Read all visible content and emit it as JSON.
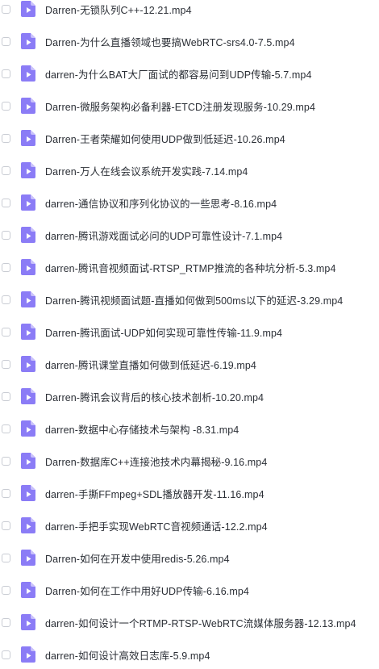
{
  "files": [
    {
      "name": "Darren-无锁队列C++-12.21.mp4"
    },
    {
      "name": "Darren-为什么直播领域也要搞WebRTC-srs4.0-7.5.mp4"
    },
    {
      "name": "darren-为什么BAT大厂面试的都容易问到UDP传输-5.7.mp4"
    },
    {
      "name": "Darren-微服务架构必备利器-ETCD注册发现服务-10.29.mp4"
    },
    {
      "name": "Darren-王者荣耀如何使用UDP做到低延迟-10.26.mp4"
    },
    {
      "name": "Darren-万人在线会议系统开发实践-7.14.mp4"
    },
    {
      "name": "darren-通信协议和序列化协议的一些思考-8.16.mp4"
    },
    {
      "name": "darren-腾讯游戏面试必问的UDP可靠性设计-7.1.mp4"
    },
    {
      "name": "darren-腾讯音视频面试-RTSP_RTMP推流的各种坑分析-5.3.mp4"
    },
    {
      "name": "Darren-腾讯视频面试题-直播如何做到500ms以下的延迟-3.29.mp4"
    },
    {
      "name": "Darren-腾讯面试-UDP如何实现可靠性传输-11.9.mp4"
    },
    {
      "name": "darren-腾讯课堂直播如何做到低延迟-6.19.mp4"
    },
    {
      "name": "Darren-腾讯会议背后的核心技术剖析-10.20.mp4"
    },
    {
      "name": "darren-数据中心存储技术与架构 -8.31.mp4"
    },
    {
      "name": "Darren-数据库C++连接池技术内幕揭秘-9.16.mp4"
    },
    {
      "name": "darren-手撕FFmpeg+SDL播放器开发-11.16.mp4"
    },
    {
      "name": "darren-手把手实现WebRTC音视频通话-12.2.mp4"
    },
    {
      "name": "Darren-如何在开发中使用redis-5.26.mp4"
    },
    {
      "name": "Darren-如何在工作中用好UDP传输-6.16.mp4"
    },
    {
      "name": "darren-如何设计一个RTMP-RTSP-WebRTC流媒体服务器-12.13.mp4"
    },
    {
      "name": "darren-如何设计高效日志库-5.9.mp4"
    }
  ],
  "colors": {
    "icon_fill": "#8b7cf6",
    "icon_fold": "#c9c1fb",
    "icon_play": "#ffffff",
    "text": "#2b2f36",
    "checkbox_border": "#c9ccd3"
  },
  "icons": {
    "file": "video-file-icon",
    "checkbox": "checkbox-icon"
  }
}
